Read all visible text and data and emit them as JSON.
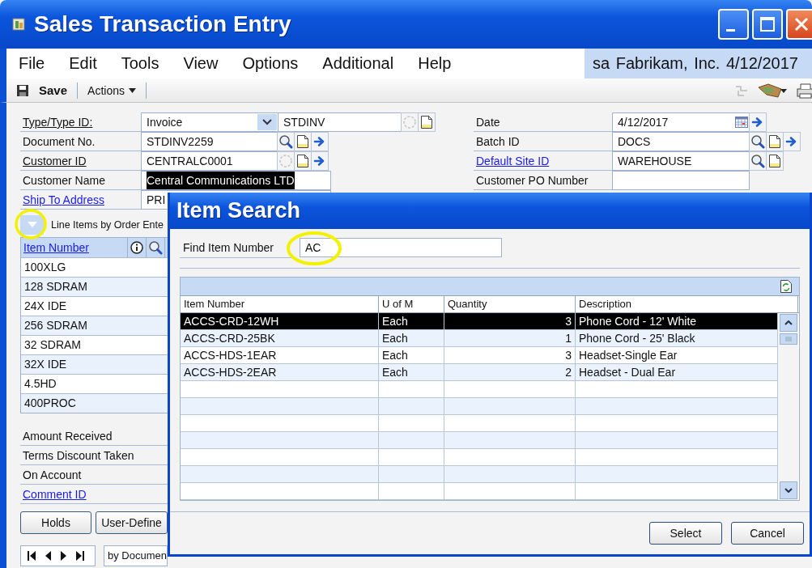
{
  "window": {
    "title": "Sales Transaction Entry"
  },
  "menu": [
    "File",
    "Edit",
    "Tools",
    "View",
    "Options",
    "Additional",
    "Help"
  ],
  "session": "sa Fabrikam, Inc. 4/12/2017",
  "toolbar": {
    "save": "Save",
    "actions": "Actions"
  },
  "header_left": [
    {
      "label": "Type/Type ID:",
      "kind": "underlined",
      "fields": [
        {
          "value": "Invoice",
          "kind": "dropdown"
        },
        {
          "value": "STDINV",
          "kind": "text"
        }
      ],
      "tools": [
        {
          "kind": "lookup-disabled"
        },
        {
          "kind": "note"
        }
      ]
    },
    {
      "label": "Document No.",
      "kind": "plain",
      "fields": [
        {
          "value": "STDINV2259",
          "kind": "text"
        }
      ],
      "tools": [
        {
          "kind": "lookup"
        },
        {
          "kind": "note"
        },
        {
          "kind": "arrow"
        }
      ]
    },
    {
      "label": "Customer ID",
      "kind": "underlined",
      "fields": [
        {
          "value": "CENTRALC0001",
          "kind": "text"
        }
      ],
      "tools": [
        {
          "kind": "lookup-disabled"
        },
        {
          "kind": "note"
        },
        {
          "kind": "arrow"
        }
      ]
    },
    {
      "label": "Customer Name",
      "kind": "plain",
      "fields": [
        {
          "value": "Central Communications LTD",
          "kind": "text",
          "highlighted": true
        }
      ]
    },
    {
      "label": "Ship To Address",
      "kind": "link",
      "fields": [
        {
          "value": "PRI",
          "kind": "text"
        }
      ]
    }
  ],
  "header_right": [
    {
      "label": "Date",
      "kind": "plain",
      "fields": [
        {
          "value": "4/12/2017",
          "kind": "date"
        }
      ],
      "tools": [
        {
          "kind": "arrow"
        }
      ]
    },
    {
      "label": "Batch ID",
      "kind": "plain",
      "fields": [
        {
          "value": "DOCS",
          "kind": "text"
        }
      ],
      "tools": [
        {
          "kind": "lookup"
        },
        {
          "kind": "note"
        },
        {
          "kind": "arrow"
        }
      ]
    },
    {
      "label": "Default Site ID",
      "kind": "link",
      "fields": [
        {
          "value": "WAREHOUSE",
          "kind": "text"
        }
      ],
      "tools": [
        {
          "kind": "lookup"
        },
        {
          "kind": "note"
        }
      ]
    },
    {
      "label": "Customer PO Number",
      "kind": "plain",
      "fields": [
        {
          "kind": "text"
        }
      ]
    }
  ],
  "line_items": {
    "title": "Line Items by Order Ente",
    "column": "Item Number",
    "rows": [
      "100XLG",
      "128 SDRAM",
      "24X IDE",
      "256 SDRAM",
      "32 SDRAM",
      "32X IDE",
      "4.5HD",
      "400PROC"
    ]
  },
  "totals": [
    {
      "label": "Amount Received",
      "kind": "plain"
    },
    {
      "label": "Terms Discount Taken",
      "kind": "plain"
    },
    {
      "label": "On Account",
      "kind": "plain"
    },
    {
      "label": "Comment ID",
      "kind": "link"
    }
  ],
  "buttons": [
    "Holds",
    "User-Define"
  ],
  "browse": {
    "sort": "by Documen"
  },
  "item_search": {
    "title": "Item Search",
    "find_label": "Find Item Number",
    "find_value": "AC",
    "columns": [
      "Item Number",
      "U of M",
      "Quantity",
      "Description"
    ],
    "rows": [
      {
        "cells": [
          "ACCS-CRD-12WH",
          "Each",
          "3",
          "Phone Cord - 12' White"
        ],
        "selected": true
      },
      {
        "cells": [
          "ACCS-CRD-25BK",
          "Each",
          "1",
          "Phone Cord - 25' Black"
        ],
        "selected": false
      },
      {
        "cells": [
          "ACCS-HDS-1EAR",
          "Each",
          "3",
          "Headset-Single Ear"
        ],
        "selected": false
      },
      {
        "cells": [
          "ACCS-HDS-2EAR",
          "Each",
          "2",
          "Headset - Dual Ear"
        ],
        "selected": false
      }
    ],
    "buttons": [
      "Select",
      "Cancel"
    ]
  }
}
